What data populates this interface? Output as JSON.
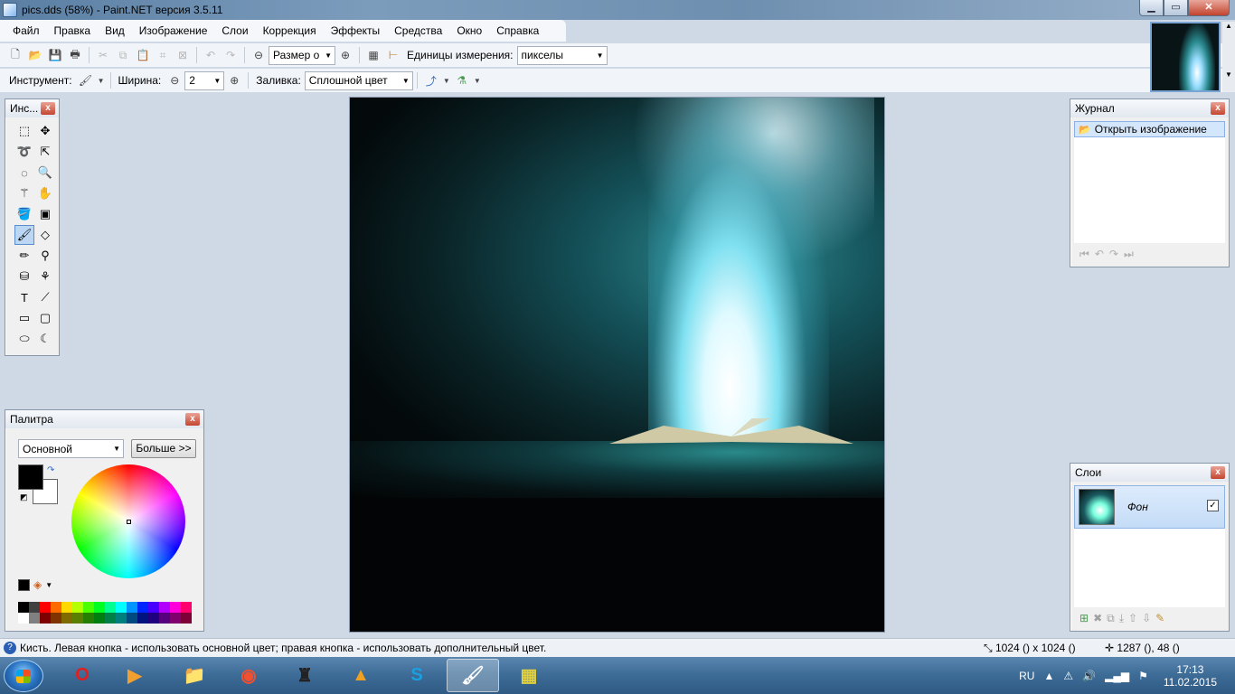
{
  "window": {
    "title": "pics.dds (58%) - Paint.NET версия 3.5.11",
    "minimize": "▁",
    "maximize": "▭",
    "close": "✕"
  },
  "menu": [
    "Файл",
    "Правка",
    "Вид",
    "Изображение",
    "Слои",
    "Коррекция",
    "Эффекты",
    "Средства",
    "Окно",
    "Справка"
  ],
  "toolbar1": {
    "zoom_combo": "Размер о",
    "units_label": "Единицы измерения:",
    "units_value": "пикселы"
  },
  "toolbar2": {
    "tool_label": "Инструмент:",
    "width_label": "Ширина:",
    "width_value": "2",
    "fill_label": "Заливка:",
    "fill_value": "Сплошной цвет"
  },
  "tools_panel": {
    "title": "Инс..."
  },
  "palette_panel": {
    "title": "Палитра",
    "mode": "Основной",
    "more_button": "Больше >>",
    "primary_color": "#000000",
    "secondary_color": "#ffffff",
    "swatches_top": [
      "#000000",
      "#404040",
      "#ff0000",
      "#ff6a00",
      "#ffd800",
      "#b6ff00",
      "#4cff00",
      "#00ff21",
      "#00ff90",
      "#00ffff",
      "#0094ff",
      "#0026ff",
      "#4800ff",
      "#b200ff",
      "#ff00dc",
      "#ff006e"
    ],
    "swatches_bottom": [
      "#ffffff",
      "#808080",
      "#7f0000",
      "#7f3300",
      "#7f6a00",
      "#5b7f00",
      "#267f00",
      "#007f0e",
      "#007f46",
      "#007f7f",
      "#004a7f",
      "#00137f",
      "#21007f",
      "#57007f",
      "#7f006e",
      "#7f0037"
    ]
  },
  "journal_panel": {
    "title": "Журнал",
    "items": [
      "Открыть изображение"
    ]
  },
  "layers_panel": {
    "title": "Слои",
    "layers": [
      {
        "name": "Фон",
        "visible": true
      }
    ]
  },
  "status": {
    "hint": "Кисть. Левая кнопка - использовать основной цвет; правая кнопка - использовать дополнительный цвет.",
    "image_size": "1024 () x 1024 ()",
    "cursor": "1287 (), 48 ()"
  },
  "taskbar": {
    "lang": "RU",
    "time": "17:13",
    "date": "11.02.2015"
  }
}
